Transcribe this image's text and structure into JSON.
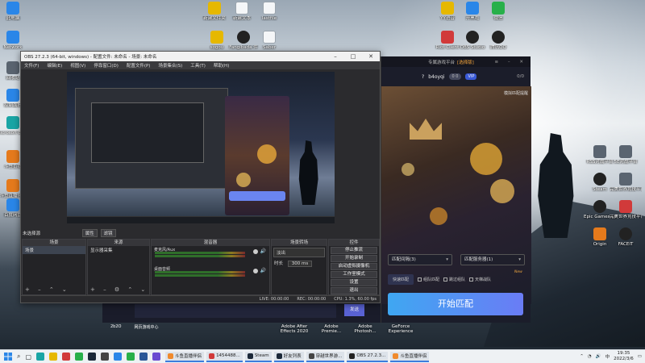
{
  "desktop_left_icons": [
    {
      "label": "此电脑",
      "icon": "computer-icon",
      "color": "g-blue"
    },
    {
      "label": "Network",
      "icon": "network-icon",
      "color": "g-blue"
    },
    {
      "label": "回收站",
      "icon": "recycle-bin-icon",
      "color": "g-gray"
    },
    {
      "label": "控制面板",
      "icon": "control-panel-icon",
      "color": "g-blue"
    },
    {
      "label": "Microsoft Edge",
      "icon": "edge-icon",
      "color": "g-teal"
    },
    {
      "label": "斗鱼直播",
      "icon": "douyu-icon",
      "color": "g-orange"
    },
    {
      "label": "斗鱼直播伴侣",
      "icon": "douyu-companion-icon",
      "color": "g-orange"
    },
    {
      "label": "百度网盘",
      "icon": "baidu-netdisk-icon",
      "color": "g-blue"
    }
  ],
  "desktop_top_icons": [
    {
      "label": "新建文件夹",
      "icon": "folder-icon",
      "color": "g-yellow"
    },
    {
      "label": "新建文本",
      "icon": "document-icon",
      "color": "g-doc"
    },
    {
      "label": "lastfile",
      "icon": "document-icon",
      "color": "g-doc"
    },
    {
      "label": "sogou",
      "icon": "sogou-icon",
      "color": "g-yellow"
    },
    {
      "label": "Fanglbada 件",
      "icon": "app-icon",
      "color": "g-dark"
    },
    {
      "label": "Saber",
      "icon": "document-icon",
      "color": "g-doc"
    }
  ],
  "desktop_right_top_icons": [
    {
      "label": "YY语音",
      "icon": "yy-icon",
      "color": "g-yellow"
    },
    {
      "label": "开黑啦",
      "icon": "kaiheila-icon",
      "color": "g-blue"
    },
    {
      "label": "微信",
      "icon": "wechat-icon",
      "color": "g-green"
    },
    {
      "label": "Riot Client",
      "icon": "riot-icon",
      "color": "g-red"
    },
    {
      "label": "OBS Studio",
      "icon": "obs-icon",
      "color": "g-dark"
    },
    {
      "label": "腾讯QQ",
      "icon": "qq-icon",
      "color": "g-dark"
    }
  ],
  "desktop_right_icons": [
    {
      "label": "RSS对战平台",
      "icon": "rss-icon",
      "color": "g-gray"
    },
    {
      "label": "5E对战平台",
      "icon": "5e-icon",
      "color": "g-gray"
    },
    {
      "label": "Steam",
      "icon": "steam-icon",
      "color": "g-dark"
    },
    {
      "label": "完美世界竞技平台",
      "icon": "perfect-world-icon",
      "color": "g-gray"
    },
    {
      "label": "Epic Games Launcher",
      "icon": "epic-icon",
      "color": "g-dark"
    },
    {
      "label": "完美世界竞技平台",
      "icon": "perfect-world-icon",
      "color": "g-red"
    },
    {
      "label": "Origin",
      "icon": "origin-icon",
      "color": "g-orange"
    },
    {
      "label": "FACEIT",
      "icon": "faceit-icon",
      "color": "g-dark"
    }
  ],
  "obs": {
    "title": "OBS 27.2.3 (64-bit, windows) - 配置文件: 未命名 - 场景: 未命名",
    "menu": [
      "文件(F)",
      "编辑(E)",
      "视图(V)",
      "停靠窗口(D)",
      "配置文件(P)",
      "场景集合(S)",
      "工具(T)",
      "帮助(H)"
    ],
    "scene_info": "未选择源",
    "scene_info_buttons": [
      "属性",
      "滤镜"
    ],
    "docks": {
      "scenes": {
        "title": "场景",
        "items": [
          "场景"
        ]
      },
      "sources": {
        "title": "来源",
        "items": [
          "显示器采集"
        ]
      },
      "mixer": {
        "title": "混音器",
        "tracks": [
          {
            "name": "麦克风/Aux"
          },
          {
            "name": "桌面音频"
          }
        ]
      },
      "transitions": {
        "title": "场景转场",
        "type": "淡出",
        "duration_label": "时长",
        "duration_value": "300 ms"
      },
      "controls": {
        "title": "控件",
        "buttons": [
          "停止推流",
          "开始录制",
          "启动虚拟摄像机",
          "工作室模式",
          "设置",
          "退出"
        ]
      }
    },
    "status": {
      "live": "LIVE: 00:00:00",
      "rec": "REC: 00:00:00",
      "cpu": "CPU: 1.3%, 60.00 fps"
    }
  },
  "gameapp": {
    "title": "专属游戏平台",
    "title_badge": "[选择版]",
    "username": "b4oyqi",
    "user_badge": "VIP",
    "user_level": "0 0",
    "online_count": "0/0",
    "helper": "模拟匹配提醒",
    "select_mode": "匹配间隔(3)",
    "select_server": "匹配服务器(1)",
    "mode_tab": "快速匹配",
    "checkbox1": "组队匹配",
    "checkbox2": "跳过组队",
    "checkbox3": "天梯战队",
    "new_tag": "New",
    "start_button": "开始匹配"
  },
  "launcher": {
    "send_label": "发送",
    "labels": [
      "2b2O",
      "网页游戏中心"
    ]
  },
  "desktop_bottom_labels": [
    "Adobe After Effects 2020",
    "Adobe Premie...",
    "Adobe Photosh...",
    "GeForce Experience"
  ],
  "taskbar": {
    "apps": [
      {
        "label": "斗鱼直播伴侣",
        "color": "#f08a2c"
      },
      {
        "label": "1454488...",
        "color": "#d13a3a"
      },
      {
        "label": "Steam",
        "color": "#1b2838"
      },
      {
        "label": "好友列表",
        "color": "#1b2838"
      },
      {
        "label": "穿越世界游...",
        "color": "#444"
      },
      {
        "label": "OBS 27.2.3...",
        "color": "#222"
      },
      {
        "label": "斗鱼直播伴侣",
        "color": "#f08a2c"
      }
    ],
    "time": "19:35",
    "date": "2022/3/6",
    "lang": "中"
  }
}
